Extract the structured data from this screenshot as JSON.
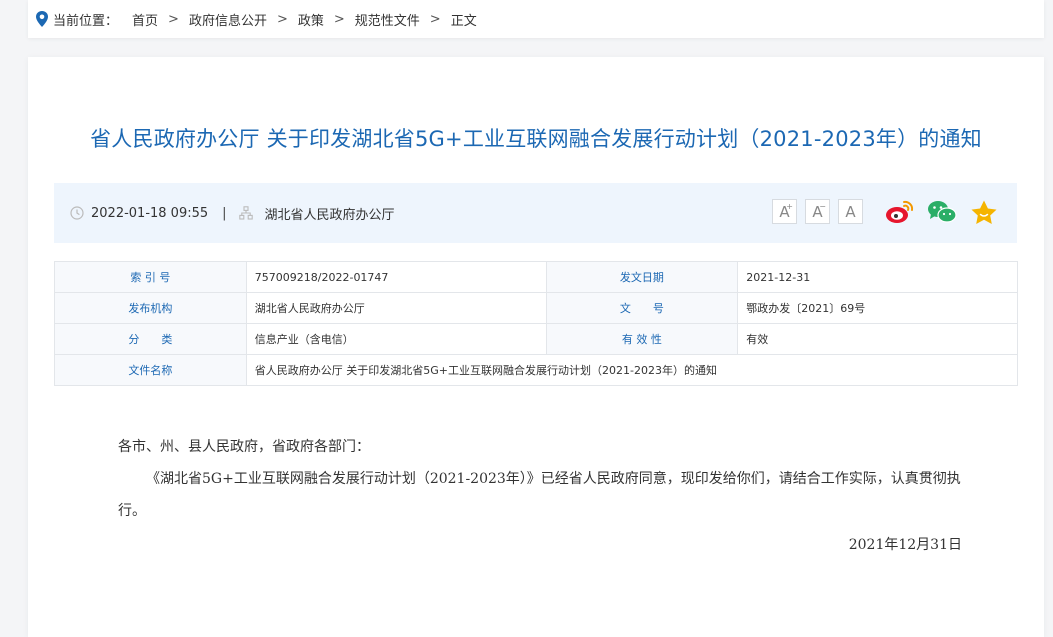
{
  "breadcrumb": {
    "lead": "当前位置：",
    "items": [
      "首页",
      "政府信息公开",
      "政策",
      "规范性文件",
      "正文"
    ],
    "separator": ">"
  },
  "article": {
    "title": "省人民政府办公厅 关于印发湖北省5G+工业互联网融合发展行动计划（2021-2023年）的通知",
    "datetime": "2022-01-18 09:55",
    "meta_separator": "|",
    "publisher": "湖北省人民政府办公厅"
  },
  "font_buttons": [
    "A",
    "A",
    "A"
  ],
  "share_icons": [
    "weibo-icon",
    "wechat-icon",
    "favorite-star-icon"
  ],
  "info_table": {
    "rows": [
      [
        "索 引 号",
        "757009218/2022-01747",
        "发文日期",
        "2021-12-31"
      ],
      [
        "发布机构",
        "湖北省人民政府办公厅",
        "文　　号",
        "鄂政办发〔2021〕69号"
      ],
      [
        "分　　类",
        "信息产业（含电信）",
        "有 效 性",
        "有效"
      ]
    ],
    "doc_name_label": "文件名称",
    "doc_name_value": "省人民政府办公厅 关于印发湖北省5G+工业互联网融合发展行动计划（2021-2023年）的通知"
  },
  "body": {
    "salutation": "各市、州、县人民政府，省政府各部门：",
    "paragraph": "《湖北省5G+工业互联网融合发展行动计划（2021-2023年）》已经省人民政府同意，现印发给你们，请结合工作实际，认真贯彻执行。",
    "date": "2021年12月31日"
  },
  "colors": {
    "accent": "#1c68b3",
    "meta_bg": "#eef5fd",
    "weibo": "#e6162d",
    "wechat": "#2aae67",
    "star": "#f5b400"
  }
}
